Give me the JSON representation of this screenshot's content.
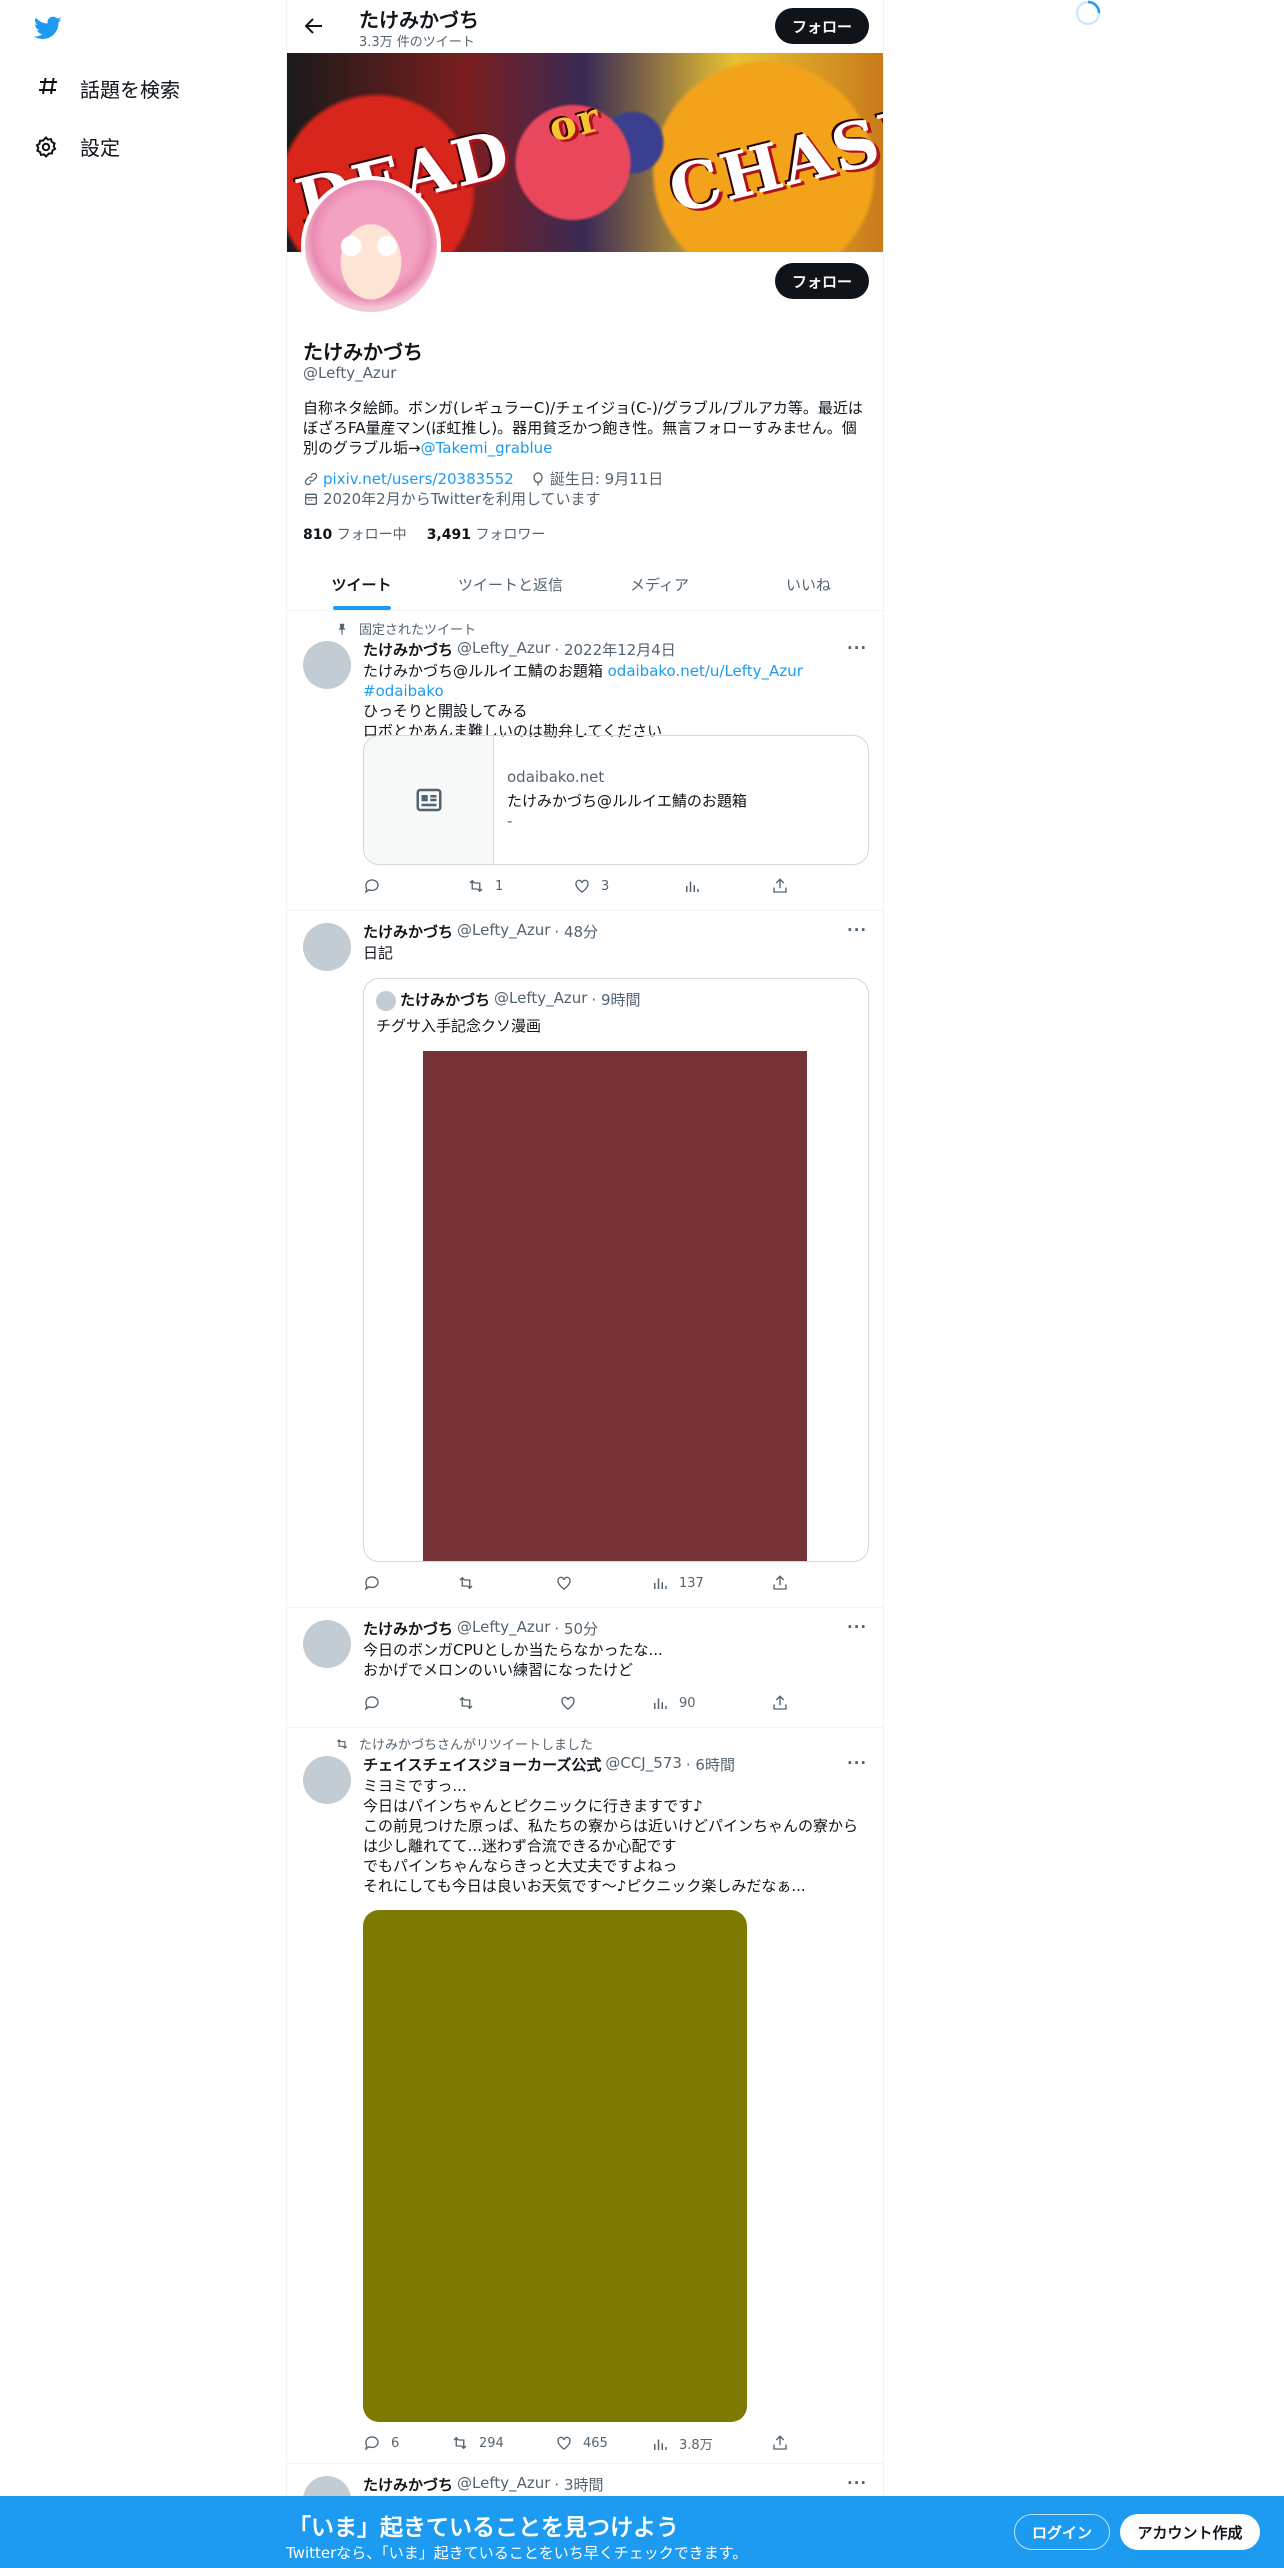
{
  "nav": {
    "logo_icon": "twitter-bird-icon",
    "items": [
      {
        "icon": "hashtag-icon",
        "label": "話題を検索"
      },
      {
        "icon": "gear-icon",
        "label": "設定"
      }
    ]
  },
  "header": {
    "name": "たけみかづち",
    "tweet_count": "3.3万 件のツイート",
    "follow_label": "フォロー"
  },
  "profile": {
    "banner_text_1": "DEAD",
    "banner_text_2": "or",
    "banner_text_3": "CHASE",
    "follow_label": "フォロー",
    "name": "たけみかづち",
    "handle": "@Lefty_Azur",
    "bio_line1": "自称ネタ絵師。ボンガ(レギュラーC)/チェイジョ(C-)/グラブル/ブルアカ等。最近は",
    "bio_line2": "ぼざろFA量産マン(ぼ虹推し)。器用貧乏かつ飽き性。無言フォローすみません。個",
    "bio_line3_text": "別のグラブル垢→",
    "bio_line3_link": "@Takemi_grablue",
    "website": "pixiv.net/users/20383552",
    "birthday": "誕生日: 9月11日",
    "joined": "2020年2月からTwitterを利用しています",
    "following_count": "810",
    "following_label": "フォロー中",
    "followers_count": "3,491",
    "followers_label": "フォロワー"
  },
  "tabs": [
    "ツイート",
    "ツイートと返信",
    "メディア",
    "いいね"
  ],
  "tweets": [
    {
      "context": "固定されたツイート",
      "name": "たけみかづち",
      "handle": "@Lefty_Azur",
      "time": "· 2022年12月4日",
      "line1_text": "たけみかづち@ルルイエ鯖のお題箱 ",
      "line1_link": "odaibako.net/u/Lefty_Azur",
      "line1_tag": "#odaibako",
      "line2": "ひっそりと開設してみる",
      "line3": "ロボとかあんま難しいのは勘弁してください",
      "card_domain": "odaibako.net",
      "card_title": "たけみかづち@ルルイエ鯖のお題箱",
      "card_desc": "-",
      "reply": "",
      "retweet": "1",
      "like": "3",
      "views": ""
    },
    {
      "name": "たけみかづち",
      "handle": "@Lefty_Azur",
      "time": "· 48分",
      "text": "日記",
      "quote_name": "たけみかづち",
      "quote_handle": "@Lefty_Azur",
      "quote_time": "· 9時間",
      "quote_text": "チグサ入手記念クソ漫画",
      "quote_media_color": "#763337",
      "reply": "",
      "retweet": "",
      "like": "",
      "views": "137"
    },
    {
      "name": "たけみかづち",
      "handle": "@Lefty_Azur",
      "time": "· 50分",
      "line1": "今日のボンガCPUとしか当たらなかったな...",
      "line2": "おかげでメロンのいい練習になったけど",
      "reply": "",
      "retweet": "",
      "like": "",
      "views": "90"
    },
    {
      "context": "たけみかづちさんがリツイートしました",
      "name": "チェイスチェイスジョーカーズ公式",
      "handle": "@CCJ_573",
      "time": "· 6時間",
      "line1": "ミヨミですっ...",
      "line2": "今日はパインちゃんとピクニックに行きますです♪",
      "line3": "この前見つけた原っぱ、私たちの寮からは近いけどパインちゃんの寮から",
      "line4": "は少し離れてて...迷わず合流できるか心配です",
      "line5": "でもパインちゃんならきっと大丈夫ですよねっ",
      "line6": "それにしても今日は良いお天気です～♪ピクニック楽しみだなぁ...",
      "media_color": "#7c7a00",
      "reply": "6",
      "retweet": "294",
      "like": "465",
      "views": "3.8万"
    },
    {
      "name": "たけみかづち",
      "handle": "@Lefty_Azur",
      "time": "· 3時間"
    }
  ],
  "bottom_bar": {
    "title": "「いま」起きていることを見つけよう",
    "subtitle": "Twitterなら、「いま」起きていることをいち早くチェックできます。",
    "login": "ログイン",
    "signup": "アカウント作成"
  },
  "colors": {
    "accent": "#1d9bf0",
    "text": "#0f1419",
    "muted": "#536471"
  }
}
